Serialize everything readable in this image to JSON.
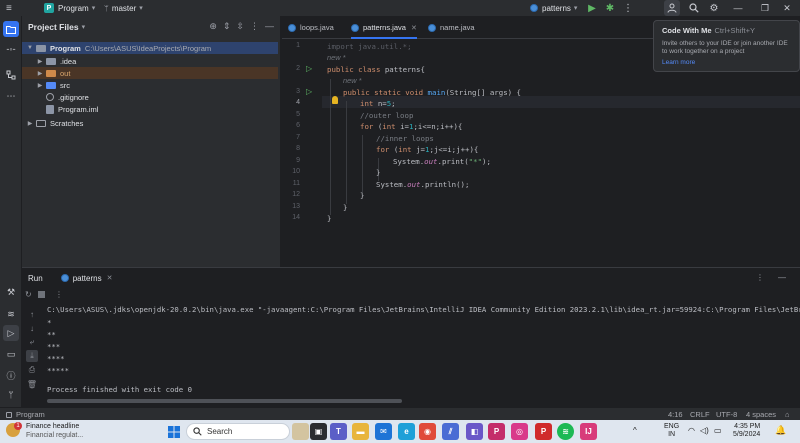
{
  "titlebar": {
    "project_badge": "P",
    "project_name": "Program",
    "branch": "master",
    "run_config": "patterns"
  },
  "project_panel": {
    "title": "Project Files",
    "tree": [
      {
        "label": "Program",
        "path": "C:\\Users\\ASUS\\IdeaProjects\\Program",
        "kind": "folder"
      },
      {
        "label": ".idea",
        "kind": "folder"
      },
      {
        "label": "out",
        "kind": "folder-excluded"
      },
      {
        "label": "src",
        "kind": "folder-source"
      },
      {
        "label": ".gitignore",
        "kind": "file"
      },
      {
        "label": "Program.iml",
        "kind": "file"
      },
      {
        "label": "Scratches",
        "kind": "folder"
      }
    ]
  },
  "editor": {
    "tabs": [
      {
        "label": "loops.java"
      },
      {
        "label": "patterns.java"
      },
      {
        "label": "name.java"
      }
    ],
    "line_numbers": [
      "1",
      "2",
      "3",
      "4",
      "5",
      "6",
      "7",
      "8",
      "9",
      "10",
      "11",
      "12",
      "13",
      "14"
    ],
    "hint_new": "new *",
    "code": {
      "l1": "import java.util.*;",
      "l3a": "public class ",
      "l3b": "patterns",
      "l3c": "{",
      "l4a": "public static void ",
      "l4b": "main",
      "l4c": "(String[] args) {",
      "l5a": "int ",
      "l5b": "n=",
      "l5c": "5",
      "l5d": ";",
      "l6": "//outer loop",
      "l7a": "for ",
      "l7b": "(",
      "l7c": "int ",
      "l7d": "i=",
      "l7e": "1",
      "l7f": ";i<=n;i++){",
      "l8": "//inner loops",
      "l9a": "for ",
      "l9b": "(",
      "l9c": "int ",
      "l9d": "j=",
      "l9e": "1",
      "l9f": ";j<=i;j++){",
      "l10a": "System.",
      "l10b": "out",
      "l10c": ".print(",
      "l10d": "\"*\"",
      "l10e": ");",
      "l11": "}",
      "l12a": "System.",
      "l12b": "out",
      "l12c": ".println();",
      "l13": "}",
      "l14": "}"
    }
  },
  "popup": {
    "title": "Code With Me",
    "shortcut": "Ctrl+Shift+Y",
    "description": "Invite others to your IDE or join another IDE to work together on a project",
    "link": "Learn more"
  },
  "run_panel": {
    "title": "Run",
    "tab": "patterns",
    "command": "C:\\Users\\ASUS\\.jdks\\openjdk-20.0.2\\bin\\java.exe \"-javaagent:C:\\Program Files\\JetBrains\\IntelliJ IDEA Community Edition 2023.2.1\\lib\\idea_rt.jar=59924:C:\\Program Files\\JetBrains",
    "output": [
      "*",
      "**",
      "***",
      "****",
      "*****"
    ],
    "exit": "Process finished with exit code 0"
  },
  "statusbar": {
    "project": "Program",
    "position": "4:16",
    "line_sep": "CRLF",
    "encoding": "UTF-8",
    "indent": "4 spaces"
  },
  "taskbar": {
    "news_title": "Finance headline",
    "news_sub": "Financial regulat...",
    "news_badge": "1",
    "search_placeholder": "Search",
    "lang1": "ENG",
    "lang2": "IN",
    "time": "4:35 PM",
    "date": "5/9/2024"
  },
  "colors": {
    "accent": "#3574f0",
    "keyword": "#cf8e6d",
    "number": "#2aacb8",
    "string": "#6aab73",
    "field": "#c77dbb"
  }
}
